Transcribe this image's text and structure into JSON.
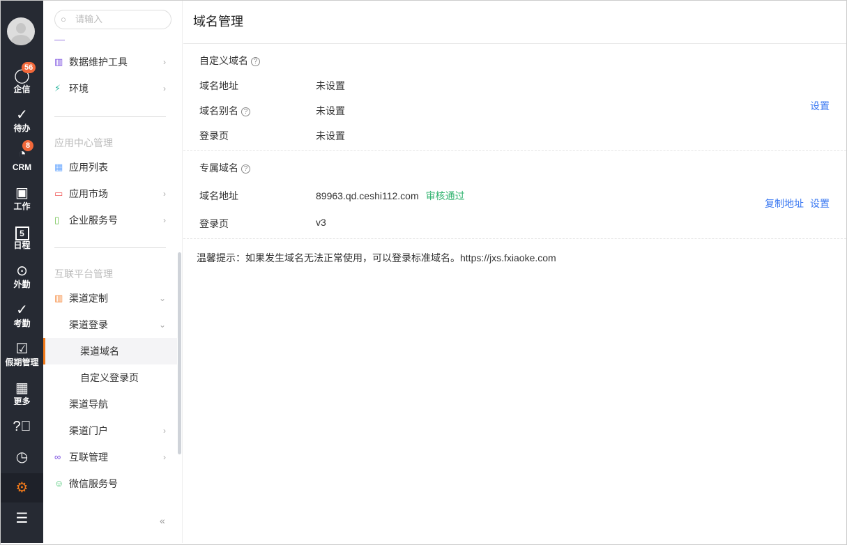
{
  "rail": [
    {
      "label": "企信",
      "icon": "chat-icon",
      "badge": "56"
    },
    {
      "label": "待办",
      "icon": "check-circle-icon"
    },
    {
      "label": "CRM",
      "icon": "pie-chart-icon",
      "badge": "8"
    },
    {
      "label": "工作",
      "icon": "briefcase-icon"
    },
    {
      "label": "日程",
      "icon": "calendar-icon",
      "day": "5"
    },
    {
      "label": "外勤",
      "icon": "location-icon"
    },
    {
      "label": "考勤",
      "icon": "attendance-icon"
    },
    {
      "label": "假期管理",
      "icon": "calendar-check-icon"
    },
    {
      "label": "更多",
      "icon": "grid-icon"
    }
  ],
  "nav": {
    "search_placeholder": "请输入",
    "items_top": [
      {
        "label": "数据维护工具"
      },
      {
        "label": "环境"
      }
    ],
    "group1": "应用中心管理",
    "group1_items": [
      {
        "label": "应用列表"
      },
      {
        "label": "应用市场"
      },
      {
        "label": "企业服务号"
      }
    ],
    "group2": "互联平台管理",
    "group2_items": [
      {
        "label": "渠道定制"
      },
      {
        "label": "渠道登录"
      },
      {
        "label": "渠道域名"
      },
      {
        "label": "自定义登录页"
      },
      {
        "label": "渠道导航"
      },
      {
        "label": "渠道门户"
      },
      {
        "label": "互联管理"
      },
      {
        "label": "微信服务号"
      }
    ]
  },
  "main": {
    "title": "域名管理",
    "custom": {
      "title": "自定义域名",
      "rows": [
        {
          "k": "域名地址",
          "v": "未设置"
        },
        {
          "k": "域名别名",
          "v": "未设置"
        },
        {
          "k": "登录页",
          "v": "未设置"
        }
      ],
      "action": "设置"
    },
    "exclusive": {
      "title": "专属域名",
      "rows": [
        {
          "k": "域名地址",
          "v": "89963.qd.ceshi112.com",
          "status": "审核通过"
        },
        {
          "k": "登录页",
          "v": "v3"
        }
      ],
      "copy": "复制地址",
      "action": "设置"
    },
    "tip": "温馨提示：如果发生域名无法正常使用，可以登录标准域名。https://jxs.fxiaoke.com"
  },
  "colors": {
    "rail": "#262a33",
    "accent": "#f27a1a",
    "link": "#3a78f2",
    "success": "#30b36f"
  }
}
